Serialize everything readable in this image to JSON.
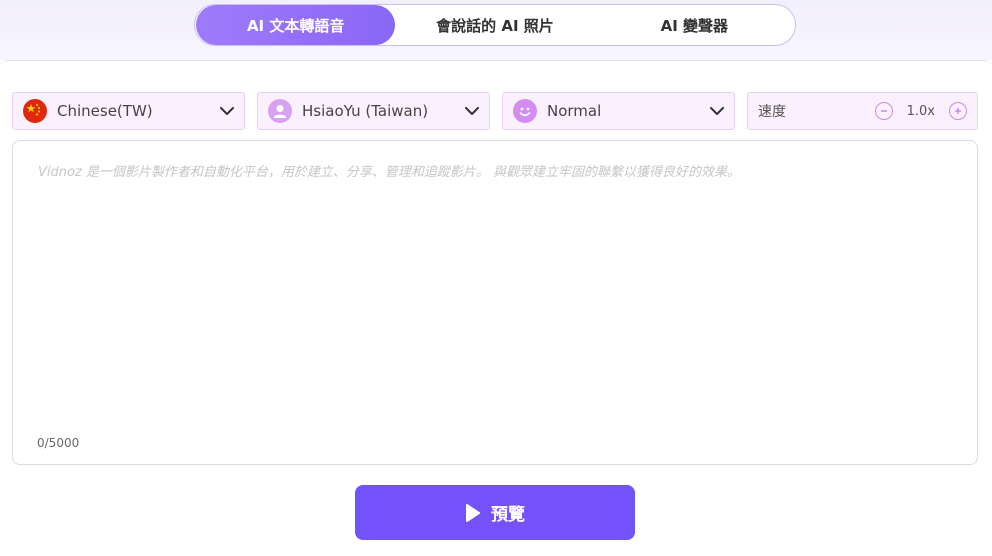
{
  "tabs": [
    {
      "label": "AI 文本轉語音",
      "active": true
    },
    {
      "label": "會說話的 AI 照片",
      "active": false
    },
    {
      "label": "AI 變聲器",
      "active": false
    }
  ],
  "controls": {
    "language": {
      "label": "Chinese(TW)",
      "icon": "china-flag-icon"
    },
    "voice": {
      "label": "HsiaoYu (Taiwan)",
      "icon": "avatar-icon"
    },
    "emotion": {
      "label": "Normal",
      "icon": "smile-icon"
    },
    "speed": {
      "label": "速度",
      "value": "1.0x"
    }
  },
  "editor": {
    "placeholder": "Vidnoz 是一個影片製作者和自動化平台，用於建立、分享、管理和追蹤影片。 與觀眾建立牢固的聯繫以獲得良好的效果。",
    "counter": "0/5000"
  },
  "preview_button": {
    "label": "預覽"
  },
  "colors": {
    "accent": "#7351fb",
    "tab_active_start": "#9f7bfb",
    "tab_active_end": "#8a66f6",
    "dropdown_bg": "#fbf1fe"
  }
}
